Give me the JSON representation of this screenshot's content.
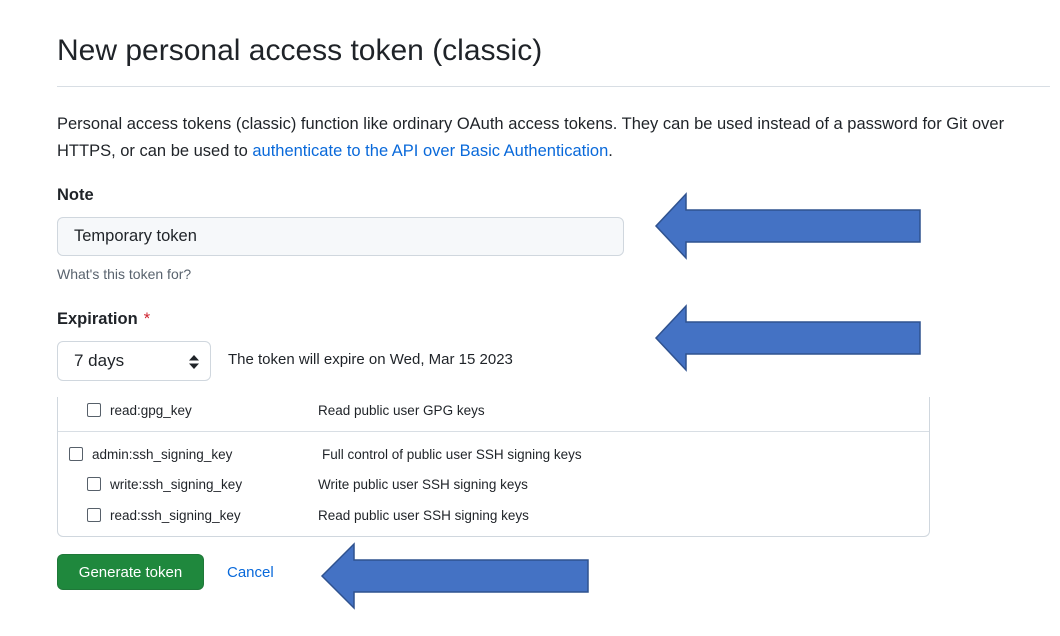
{
  "page": {
    "title": "New personal access token (classic)",
    "description_prefix": "Personal access tokens (classic) function like ordinary OAuth access tokens. They can be used instead of a password for Git over HTTPS, or can be used to ",
    "description_link": "authenticate to the API over Basic Authentication",
    "description_suffix": "."
  },
  "note": {
    "label": "Note",
    "value": "Temporary token",
    "hint": "What's this token for?"
  },
  "expiration": {
    "label": "Expiration",
    "required_mark": "*",
    "selected": "7 days",
    "expire_text": "The token will expire on Wed, Mar 15 2023"
  },
  "scopes": [
    {
      "name": "read:gpg_key",
      "description": "Read public user GPG keys",
      "checked": false
    },
    {
      "name": "admin:ssh_signing_key",
      "description": "Full control of public user SSH signing keys",
      "checked": false
    },
    {
      "name": "write:ssh_signing_key",
      "description": "Write public user SSH signing keys",
      "checked": false
    },
    {
      "name": "read:ssh_signing_key",
      "description": "Read public user SSH signing keys",
      "checked": false
    }
  ],
  "actions": {
    "generate_label": "Generate token",
    "cancel_label": "Cancel"
  },
  "colors": {
    "primary_button": "#1f883d",
    "link": "#0969da",
    "required": "#cf222e",
    "annotation_arrow": "#4472c4"
  },
  "icons": {
    "select_caret": "up-down-caret-icon",
    "annotation": "left-arrow-icon"
  }
}
